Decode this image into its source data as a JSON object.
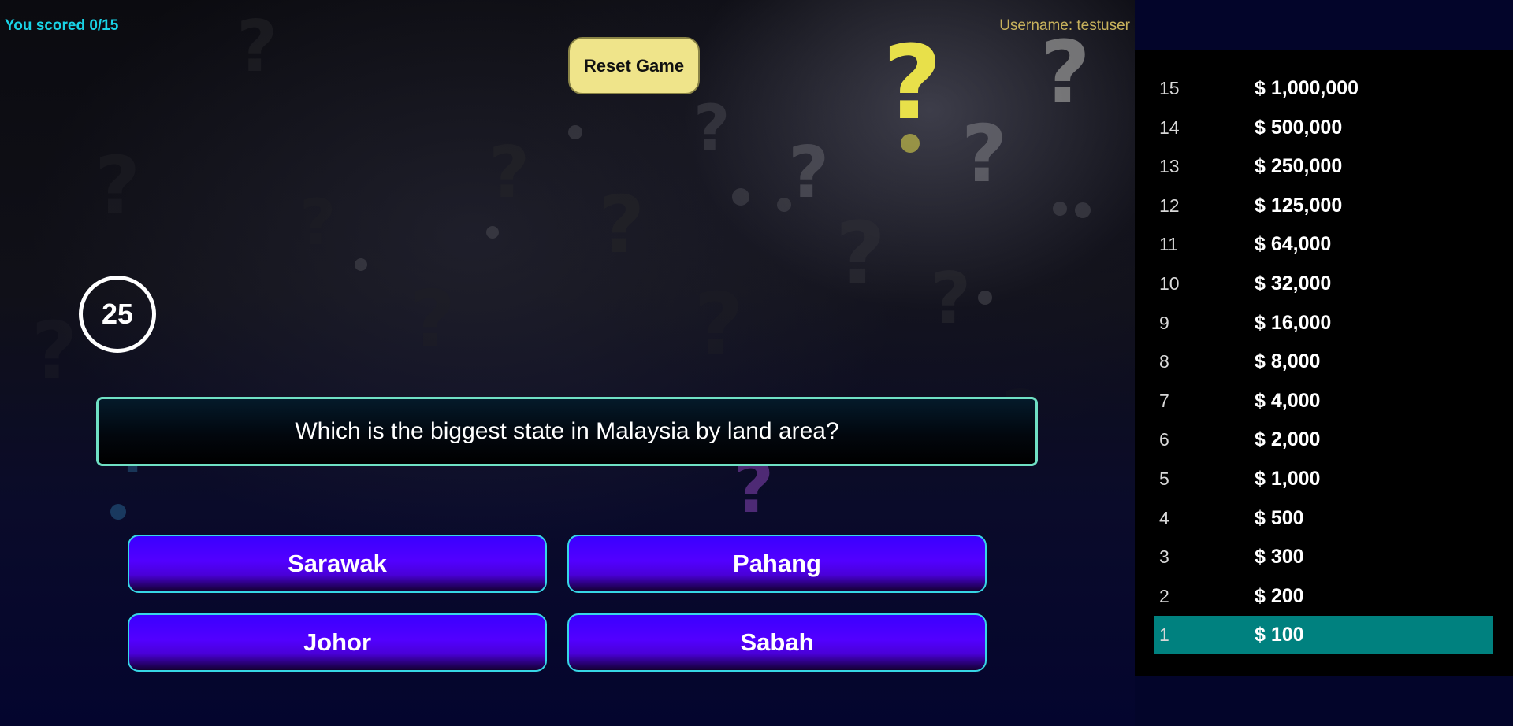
{
  "header": {
    "score_text": "You scored 0/15",
    "username_text": "Username: testuser",
    "reset_label": "Reset Game"
  },
  "timer": {
    "seconds": "25"
  },
  "question": {
    "text": "Which is the biggest state in Malaysia by land area?"
  },
  "answers": [
    {
      "label": "Sarawak"
    },
    {
      "label": "Pahang"
    },
    {
      "label": "Johor"
    },
    {
      "label": "Sabah"
    }
  ],
  "ladder": [
    {
      "number": "15",
      "amount": "$ 1,000,000"
    },
    {
      "number": "14",
      "amount": "$ 500,000"
    },
    {
      "number": "13",
      "amount": "$ 250,000"
    },
    {
      "number": "12",
      "amount": "$ 125,000"
    },
    {
      "number": "11",
      "amount": "$ 64,000"
    },
    {
      "number": "10",
      "amount": "$ 32,000"
    },
    {
      "number": "9",
      "amount": "$ 16,000"
    },
    {
      "number": "8",
      "amount": "$ 8,000"
    },
    {
      "number": "7",
      "amount": "$ 4,000"
    },
    {
      "number": "6",
      "amount": "$ 2,000"
    },
    {
      "number": "5",
      "amount": "$ 1,000"
    },
    {
      "number": "4",
      "amount": "$ 500"
    },
    {
      "number": "3",
      "amount": "$ 300"
    },
    {
      "number": "2",
      "amount": "$ 200"
    },
    {
      "number": "1",
      "amount": "$ 100",
      "active": true
    }
  ],
  "colors": {
    "score": "#19d3e6",
    "username": "#c8b25c",
    "reset_button": "#efe48a",
    "answer_button": "#5200ff",
    "answer_border": "#37d6e6",
    "question_border": "#6fe0c4",
    "ladder_active": "#00817f"
  }
}
